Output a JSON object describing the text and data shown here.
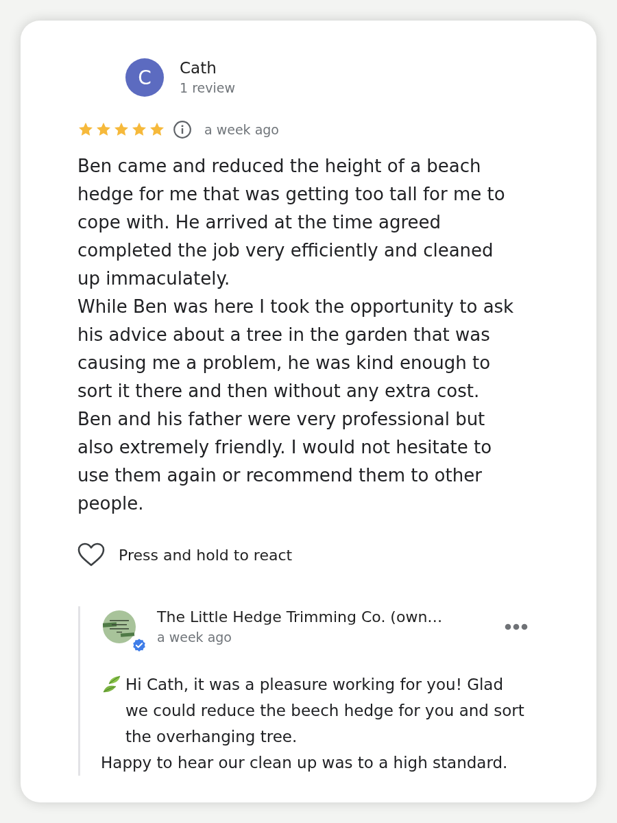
{
  "review": {
    "author": {
      "initial": "C",
      "name": "Cath",
      "review_count": "1 review"
    },
    "stars": 5,
    "time": "a week ago",
    "paragraphs": [
      "Ben came and reduced the height of a beach hedge for me that was getting too tall for me to cope with. He arrived at the time agreed completed the job very efficiently and cleaned up immaculately.",
      "While Ben was here I took the opportunity to ask his advice about a tree in the garden that was causing me a problem, he was kind enough to sort it there and then without any extra cost.",
      "Ben and his father were very professional but also extremely friendly. I would not hesitate to use them again or recommend them to other people."
    ]
  },
  "reaction": {
    "label": "Press and hold to react"
  },
  "owner_reply": {
    "name": "The Little Hedge Trimming Co. (own…",
    "verified": true,
    "time": "a week ago",
    "paragraphs": [
      {
        "kind": "leaf",
        "text": "Hi Cath, it was a pleasure working for you! Glad we could reduce the beech hedge for you and sort the overhanging tree."
      },
      {
        "kind": "plain",
        "text": "Happy to hear our clean up was to a high standard."
      }
    ]
  }
}
